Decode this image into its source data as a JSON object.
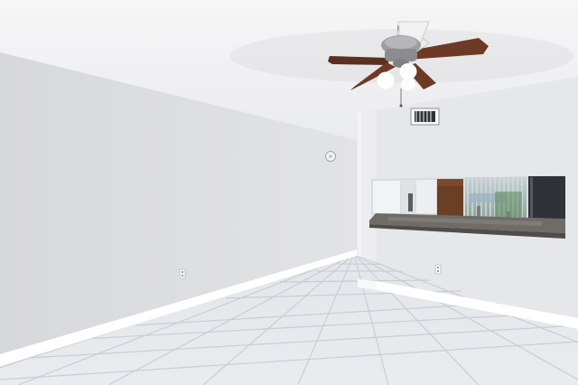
{
  "scene": {
    "icons": {
      "ceiling_fan": "ceiling-fan-icon",
      "smoke_detector": "smoke-detector-icon",
      "air_vent": "air-vent-icon",
      "electrical_outlets": "electrical-outlet-icon"
    },
    "colors": {
      "ceiling": "#f2f2f3",
      "left_wall": "#dcdde0",
      "back_wall": "#e9eaec",
      "right_wall": "#e5e6e8",
      "floor_tile": "#e4e7ea",
      "grout": "#c9cdd3",
      "baseboard": "#ffffff",
      "fan_blade": "#6e3a26",
      "countertop": "#6f6c68",
      "cabinet": "#6b3f25"
    }
  }
}
